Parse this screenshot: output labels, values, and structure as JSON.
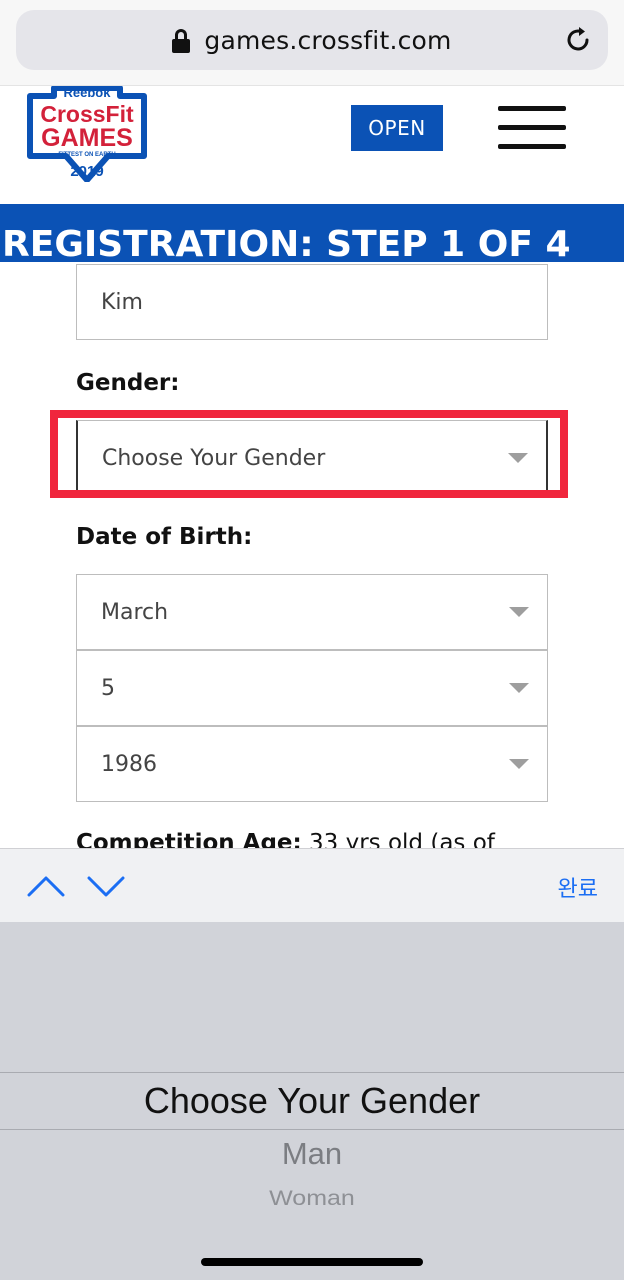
{
  "browser": {
    "url": "games.crossfit.com",
    "lock_icon": "lock-icon",
    "reload_icon": "reload-icon"
  },
  "header": {
    "logo": {
      "brand_top": "Reebok",
      "brand_mid": "CrossFit",
      "brand_main": "GAMES",
      "tagline": "FITTEST ON EARTH",
      "year": "2019"
    },
    "open_button_label": "OPEN",
    "menu_icon": "hamburger-menu-icon",
    "brand_color": "#0b52b5"
  },
  "banner": {
    "title": "REGISTRATION: STEP 1 OF 4"
  },
  "form": {
    "last_name_value": "Kim",
    "gender_label": "Gender:",
    "gender_value": "Choose Your Gender",
    "dob_label": "Date of Birth:",
    "dob_month": "March",
    "dob_day": "5",
    "dob_year": "1986",
    "age_label": "Competition Age:",
    "age_value": "33 yrs old (as of",
    "highlight_color": "#f0263d"
  },
  "keyboard_toolbar": {
    "prev_icon": "chevron-up-icon",
    "next_icon": "chevron-down-icon",
    "done_label": "완료",
    "accent_color": "#1b6ef3"
  },
  "picker": {
    "selected": "Choose Your Gender",
    "options": [
      "Man",
      "Woman"
    ]
  }
}
